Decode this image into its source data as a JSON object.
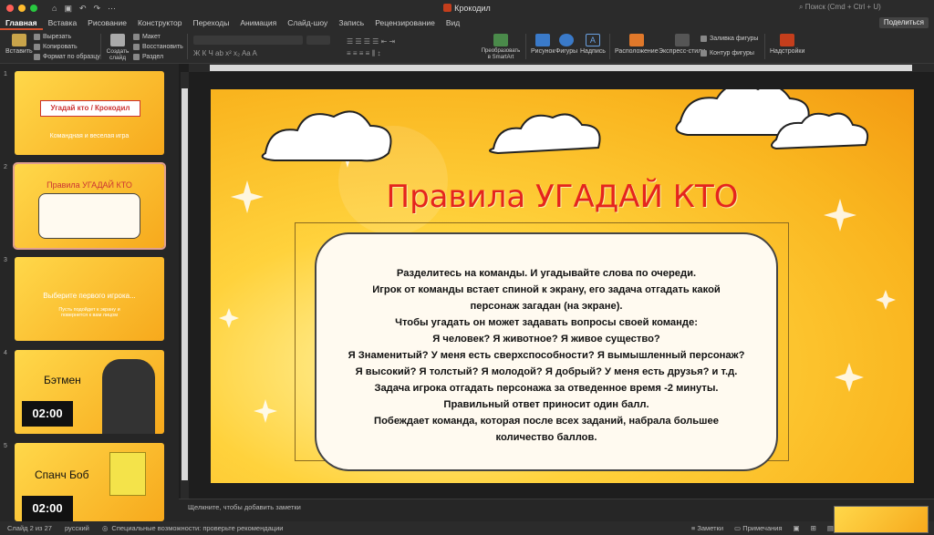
{
  "window": {
    "title": "Крокодил",
    "search_placeholder": "Поиск (Cmd + Ctrl + U)"
  },
  "tabs": [
    "Главная",
    "Вставка",
    "Рисование",
    "Конструктор",
    "Переходы",
    "Анимация",
    "Слайд-шоу",
    "Запись",
    "Рецензирование",
    "Вид"
  ],
  "share_label": "Поделиться",
  "ribbon": {
    "paste": "Вставить",
    "cut": "Вырезать",
    "copy": "Копировать",
    "format": "Формат по образцу",
    "new_slide": "Создать слайд",
    "layout": "Макет",
    "reset": "Восстановить",
    "section": "Раздел",
    "smartart": "Преобразовать в SmartArt",
    "picture": "Рисунок",
    "shapes": "Фигуры",
    "textbox": "Надпись",
    "arrange": "Расположение",
    "quick_styles": "Экспресс-стили",
    "shape_fill": "Заливка фигуры",
    "shape_outline": "Контур фигуры",
    "addins": "Надстройки"
  },
  "slides": [
    {
      "num": "1",
      "title": "Угадай кто / Крокодил",
      "subtitle": "Командная и веселая игра"
    },
    {
      "num": "2",
      "title": "Правила УГАДАЙ КТО"
    },
    {
      "num": "3",
      "title": "Выберите первого игрока...",
      "subtitle": "Пусть подойдет к экрану и повернется к вам лицом"
    },
    {
      "num": "4",
      "title": "Бэтмен",
      "timer": "02:00"
    },
    {
      "num": "5",
      "title": "Спанч Боб",
      "timer": "02:00"
    }
  ],
  "slide": {
    "title": "Правила УГАДАЙ КТО",
    "lines": [
      "Разделитесь на команды. И угадывайте слова по очереди.",
      "Игрок от команды встает спиной к экрану, его задача отгадать какой",
      "персонаж загадан (на экране).",
      "Чтобы угадать он может задавать вопросы своей команде:",
      "Я человек? Я животное? Я живое существо?",
      "Я Знаменитый? У меня есть сверхспособности? Я вымышленный персонаж?",
      "Я высокий? Я толстый? Я молодой? Я добрый? У меня есть друзья? и т.д.",
      "Задача игрока отгадать персонажа за отведенное время -2 минуты.",
      "Правильный ответ приносит один балл.",
      "Побеждает команда, которая после всех заданий, набрала большее",
      "количество баллов."
    ]
  },
  "notes_placeholder": "Щелкните, чтобы добавить заметки",
  "status": {
    "slide_of": "Слайд 2 из 27",
    "language": "русский",
    "accessibility": "Специальные возможности: проверьте рекомендации",
    "notes_btn": "Заметки",
    "comments_btn": "Примечания"
  }
}
